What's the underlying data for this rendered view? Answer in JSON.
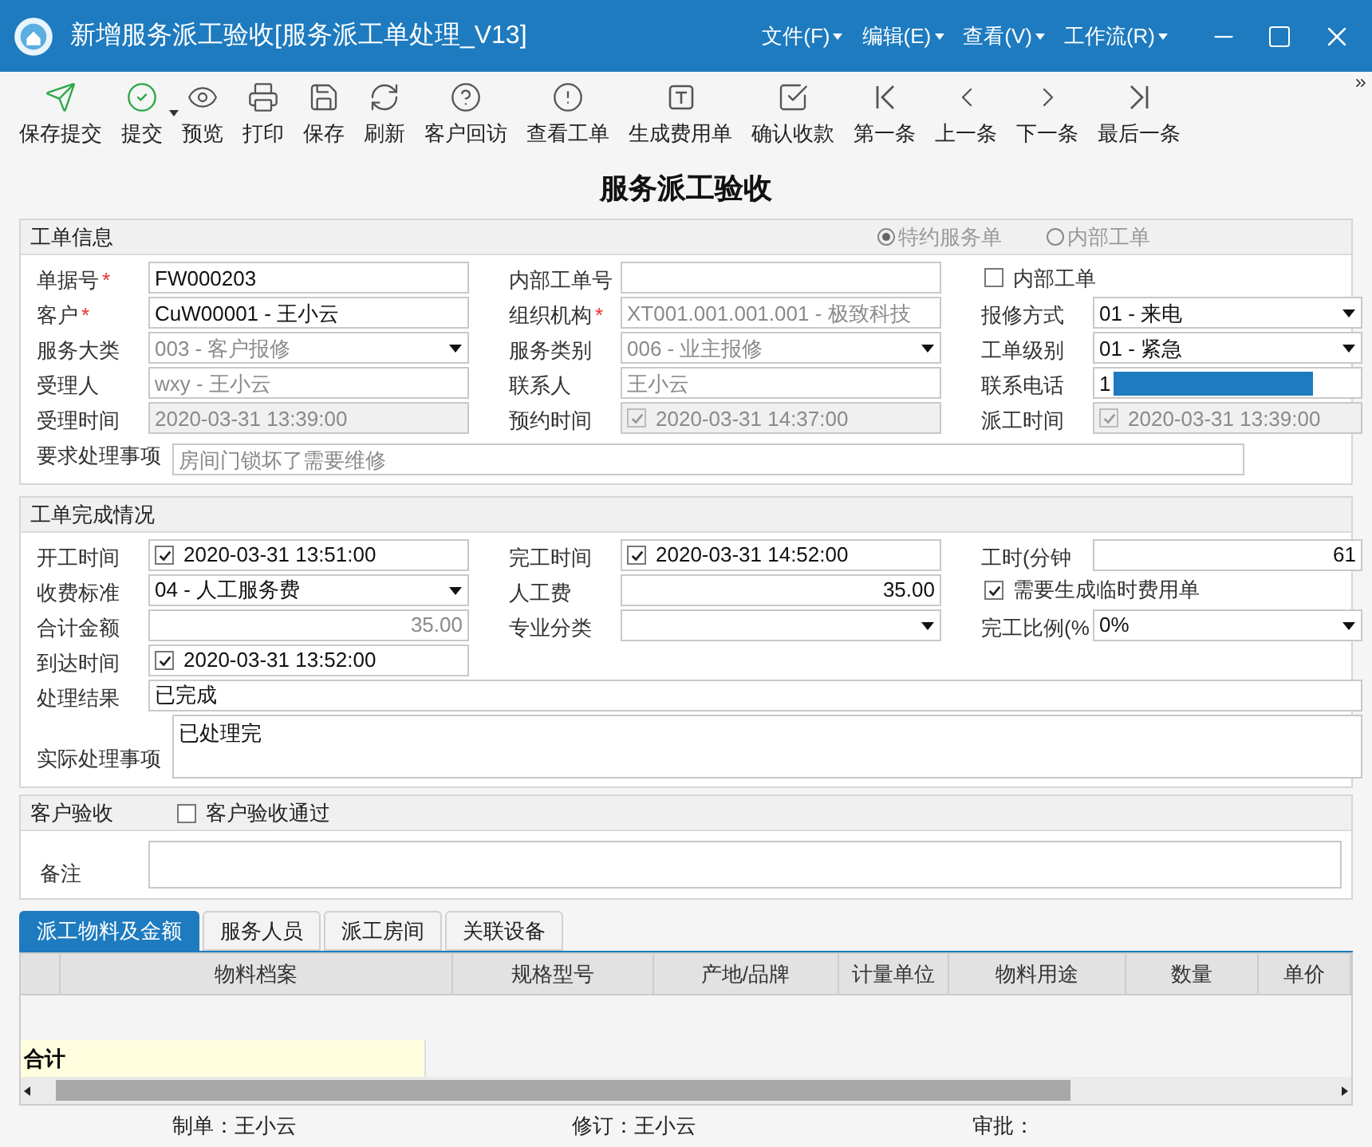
{
  "window": {
    "title": "新增服务派工验收[服务派工单处理_V13]",
    "menus": [
      "文件(F)",
      "编辑(E)",
      "查看(V)",
      "工作流(R)"
    ]
  },
  "toolbar": [
    {
      "label": "保存提交",
      "has_menu": false
    },
    {
      "label": "提交",
      "has_menu": true
    },
    {
      "label": "预览",
      "has_menu": false
    },
    {
      "label": "打印",
      "has_menu": false
    },
    {
      "label": "保存",
      "has_menu": false
    },
    {
      "label": "刷新",
      "has_menu": false
    },
    {
      "label": "客户回访",
      "has_menu": false
    },
    {
      "label": "查看工单",
      "has_menu": false
    },
    {
      "label": "生成费用单",
      "has_menu": false
    },
    {
      "label": "确认收款",
      "has_menu": false
    },
    {
      "label": "第一条",
      "has_menu": false
    },
    {
      "label": "上一条",
      "has_menu": false
    },
    {
      "label": "下一条",
      "has_menu": false
    },
    {
      "label": "最后一条",
      "has_menu": false
    }
  ],
  "page_title": "服务派工验收",
  "order_info": {
    "title": "工单信息",
    "radios": [
      {
        "label": "特约服务单",
        "selected": true
      },
      {
        "label": "内部工单",
        "selected": false
      }
    ],
    "rows": [
      [
        {
          "kind": "text",
          "label": "单据号",
          "required_mark": "*",
          "value": "FW000203",
          "disabled": false
        },
        {
          "kind": "text",
          "label": "内部工单号"
        },
        {
          "kind": "checkbox",
          "label": "内部工单",
          "checked": false
        }
      ],
      [
        {
          "kind": "text",
          "label": "客户",
          "required_mark": "*",
          "value": "CuW00001  - 王小云",
          "disabled": false
        },
        {
          "kind": "text",
          "label": "组织机构",
          "required_mark": "*",
          "value": "XT001.001.001.001  - 极致科技",
          "disabled": true
        },
        {
          "kind": "select",
          "label": "报修方式",
          "value": "01 - 来电",
          "disabled": false
        }
      ],
      [
        {
          "kind": "select",
          "label": "服务大类",
          "value": "003 - 客户报修",
          "disabled": true
        },
        {
          "kind": "select",
          "label": "服务类别",
          "value": "006 - 业主报修",
          "disabled": true
        },
        {
          "kind": "select",
          "label": "工单级别",
          "value": "01 - 紧急",
          "disabled": false
        }
      ],
      [
        {
          "kind": "text",
          "label": "受理人",
          "value": "wxy - 王小云",
          "disabled": true
        },
        {
          "kind": "text",
          "label": "联系人",
          "value": "王小云",
          "disabled": true
        },
        {
          "kind": "redacted",
          "label": "联系电话",
          "value": "1",
          "disabled": false
        }
      ],
      [
        {
          "kind": "time",
          "label": "受理时间",
          "value": "2020-03-31 13:39:00",
          "disabled": true
        },
        {
          "kind": "checktime",
          "label": "预约时间",
          "value": "2020-03-31 14:37:00",
          "checked": true,
          "disabled": true
        },
        {
          "kind": "checktime",
          "label": "派工时间",
          "value": "2020-03-31 13:39:00",
          "checked": true,
          "disabled": true
        }
      ],
      [
        {
          "kind": "wide",
          "label": "要求处理事项",
          "value": "房间门锁坏了需要维修",
          "disabled": true
        }
      ]
    ]
  },
  "completion": {
    "title": "工单完成情况",
    "rows": [
      [
        {
          "kind": "checktime",
          "label": "开工时间",
          "value": "2020-03-31 13:51:00",
          "checked": true,
          "disabled": false
        },
        {
          "kind": "checktime",
          "label": "完工时间",
          "value": "2020-03-31 14:52:00",
          "checked": true,
          "disabled": false
        },
        {
          "kind": "number",
          "label": "工时(分钟",
          "value": "61",
          "disabled": false
        }
      ],
      [
        {
          "kind": "select",
          "label": "收费标准",
          "value": "04 - 人工服务费",
          "disabled": false
        },
        {
          "kind": "number",
          "label": "人工费",
          "value": "35.00",
          "disabled": false
        },
        {
          "kind": "checkbox",
          "label": "需要生成临时费用单",
          "checked": true
        }
      ],
      [
        {
          "kind": "number",
          "label": "合计金额",
          "value": "35.00",
          "disabled": true
        },
        {
          "kind": "select",
          "label": "专业分类"
        },
        {
          "kind": "select",
          "label": "完工比例(%",
          "value": "0%",
          "disabled": false
        }
      ],
      [
        {
          "kind": "checktime",
          "label": "到达时间",
          "value": "2020-03-31 13:52:00",
          "checked": true,
          "disabled": false
        }
      ],
      [
        {
          "kind": "full",
          "label": "处理结果",
          "value": "已完成",
          "disabled": false
        }
      ],
      [
        {
          "kind": "memo",
          "label": "实际处理事项",
          "value": "已处理完",
          "disabled": false
        }
      ]
    ]
  },
  "acceptance": {
    "title": "客户验收",
    "check": {
      "label": "客户验收通过",
      "checked": false
    },
    "remark_label": "备注"
  },
  "tabs": [
    {
      "label": "派工物料及金额",
      "selected": true
    },
    {
      "label": "服务人员",
      "selected": false
    },
    {
      "label": "派工房间",
      "selected": false
    },
    {
      "label": "关联设备",
      "selected": false
    }
  ],
  "table": {
    "columns": [
      "物料档案",
      "规格型号",
      "产地/品牌",
      "计量单位",
      "物料用途",
      "数量",
      "单价"
    ],
    "total_label": "合计"
  },
  "footer": [
    "制单：王小云",
    "修订：王小云",
    "审批："
  ]
}
